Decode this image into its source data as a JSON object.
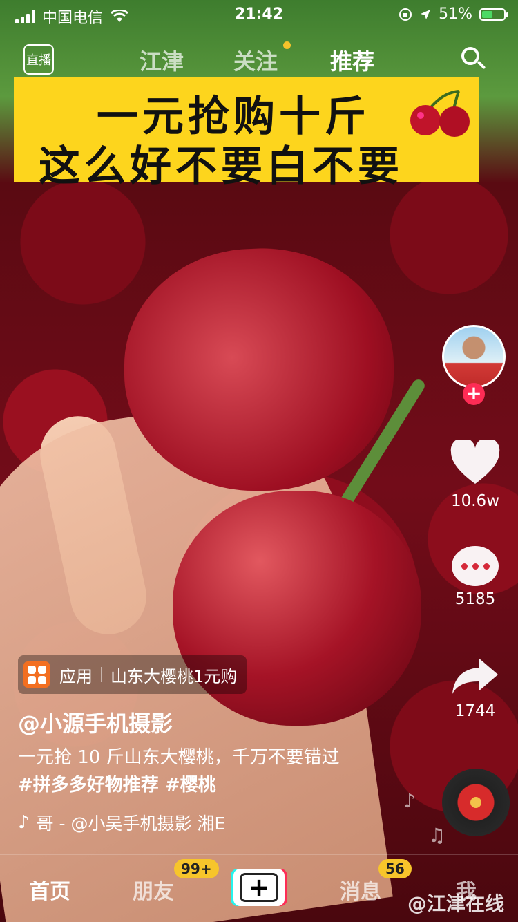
{
  "status_bar": {
    "carrier": "中国电信",
    "time": "21:42",
    "battery_percent": "51%",
    "battery_level": 0.51
  },
  "top_nav": {
    "live_label": "直播",
    "tabs": [
      "江津",
      "关注",
      "推荐"
    ],
    "active_tab": "推荐"
  },
  "banner": {
    "line1": "一元抢购十斤",
    "line2": "这么好不要白不要"
  },
  "side_actions": {
    "like_count": "10.6w",
    "comment_count": "5185",
    "share_count": "1744"
  },
  "app_badge": {
    "type_label": "应用",
    "title": "山东大樱桃1元购"
  },
  "video_info": {
    "author": "@小源手机摄影",
    "description": "一元抢 10 斤山东大樱桃，千万不要错过",
    "hashtags": "#拼多多好物推荐 #樱桃",
    "music": "哥 - @小吴手机摄影   湘E"
  },
  "bottom_nav": {
    "home": "首页",
    "friends": "朋友",
    "friends_badge": "99+",
    "add": "+",
    "messages": "消息",
    "messages_badge": "56",
    "me": "我"
  },
  "watermark": "@江津在线",
  "colors": {
    "accent_red": "#fe2c55",
    "badge_yellow": "#f7c52b",
    "banner_yellow": "#fdd51d"
  }
}
